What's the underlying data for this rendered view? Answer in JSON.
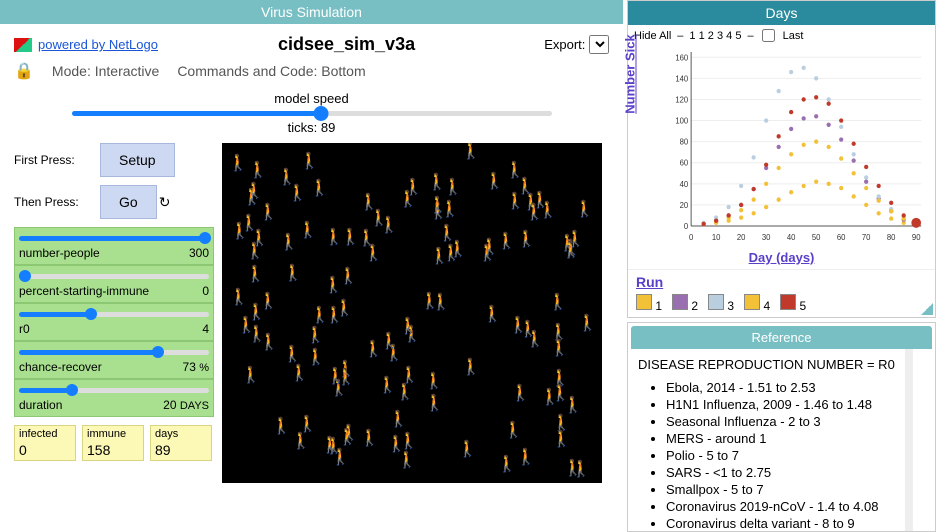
{
  "left": {
    "title": "Virus Simulation",
    "powered": "powered by NetLogo",
    "model_name": "cidsee_sim_v3a",
    "export_label": "Export:",
    "mode_label": "Mode: Interactive",
    "commands_label": "Commands and Code: Bottom",
    "speed_label": "model speed",
    "ticks_label": "ticks: 89",
    "first_press": "First Press:",
    "then_press": "Then Press:",
    "setup_btn": "Setup",
    "go_btn": "Go",
    "sliders": [
      {
        "name": "number-people",
        "value": "300",
        "unit": "",
        "pct": 98
      },
      {
        "name": "percent-starting-immune",
        "value": "0",
        "unit": "",
        "pct": 3
      },
      {
        "name": "r0",
        "value": "4",
        "unit": "",
        "pct": 38
      },
      {
        "name": "chance-recover",
        "value": "73",
        "unit": "%",
        "pct": 73
      },
      {
        "name": "duration",
        "value": "20",
        "unit": "DAYS",
        "pct": 28
      }
    ],
    "monitors": [
      {
        "label": "infected",
        "value": "0"
      },
      {
        "label": "immune",
        "value": "158"
      },
      {
        "label": "days",
        "value": "89"
      }
    ]
  },
  "days_panel": {
    "title": "Days",
    "hide_all": "Hide All",
    "last": "Last",
    "run_nums": [
      "1",
      "1",
      "2",
      "3",
      "4",
      "5"
    ],
    "ylabel": "Number Sick",
    "xlabel": "Day (days)",
    "yticks": [
      "0",
      "20",
      "40",
      "60",
      "80",
      "100",
      "120",
      "140",
      "160"
    ],
    "xticks": [
      "0",
      "10",
      "20",
      "30",
      "40",
      "50",
      "60",
      "70",
      "80",
      "90"
    ],
    "run_label": "Run",
    "legend": [
      {
        "n": "1",
        "c": "#f3c137"
      },
      {
        "n": "2",
        "c": "#9a6fb0"
      },
      {
        "n": "3",
        "c": "#b9cfe0"
      },
      {
        "n": "4",
        "c": "#f3c137"
      },
      {
        "n": "5",
        "c": "#c0392b"
      }
    ]
  },
  "reference": {
    "title": "Reference",
    "heading": "DISEASE REPRODUCTION NUMBER = R0",
    "items": [
      "Ebola, 2014 - 1.51 to 2.53",
      "H1N1 Influenza, 2009 -    1.46 to 1.48",
      "Seasonal Influenza -  2 to 3",
      "MERS - around 1",
      "Polio - 5 to 7",
      "SARS - <1 to 2.75",
      "Smallpox - 5 to 7",
      "Coronavirus 2019-nCoV - 1.4 to 4.08",
      "Coronavirus delta variant - 8 to 9"
    ]
  },
  "chart_data": {
    "type": "line",
    "title": "Days",
    "xlabel": "Day (days)",
    "ylabel": "Number Sick",
    "xlim": [
      0,
      92
    ],
    "ylim": [
      0,
      165
    ],
    "series": [
      {
        "name": "1",
        "color": "#f3c137",
        "x": [
          5,
          10,
          15,
          20,
          25,
          30,
          35,
          40,
          45,
          50,
          55,
          60,
          65,
          70,
          75,
          80,
          85,
          90
        ],
        "y": [
          2,
          3,
          5,
          8,
          12,
          18,
          25,
          32,
          38,
          42,
          40,
          36,
          28,
          20,
          12,
          7,
          3,
          1
        ]
      },
      {
        "name": "2",
        "color": "#9a6fb0",
        "x": [
          5,
          10,
          15,
          20,
          25,
          30,
          35,
          40,
          45,
          50,
          55,
          60,
          65,
          70,
          75,
          80,
          85,
          90
        ],
        "y": [
          2,
          5,
          10,
          20,
          35,
          55,
          75,
          92,
          102,
          104,
          96,
          82,
          62,
          42,
          26,
          14,
          6,
          2
        ]
      },
      {
        "name": "3",
        "color": "#b9cfe0",
        "x": [
          5,
          10,
          15,
          20,
          25,
          30,
          35,
          40,
          45,
          50,
          55,
          60,
          65,
          70,
          75,
          80,
          85,
          90
        ],
        "y": [
          3,
          8,
          18,
          38,
          65,
          100,
          128,
          146,
          150,
          140,
          120,
          94,
          68,
          46,
          28,
          16,
          8,
          3
        ]
      },
      {
        "name": "4",
        "color": "#f3c137",
        "x": [
          5,
          10,
          15,
          20,
          25,
          30,
          35,
          40,
          45,
          50,
          55,
          60,
          65,
          70,
          75,
          80,
          85,
          90
        ],
        "y": [
          2,
          4,
          8,
          15,
          25,
          40,
          55,
          68,
          77,
          80,
          75,
          64,
          50,
          36,
          24,
          14,
          7,
          2
        ]
      },
      {
        "name": "5",
        "color": "#c0392b",
        "x": [
          5,
          10,
          15,
          20,
          25,
          30,
          35,
          40,
          45,
          50,
          55,
          60,
          65,
          70,
          75,
          80,
          85,
          90
        ],
        "y": [
          2,
          5,
          10,
          20,
          35,
          58,
          85,
          108,
          120,
          122,
          116,
          100,
          78,
          56,
          38,
          22,
          10,
          3
        ]
      }
    ]
  }
}
